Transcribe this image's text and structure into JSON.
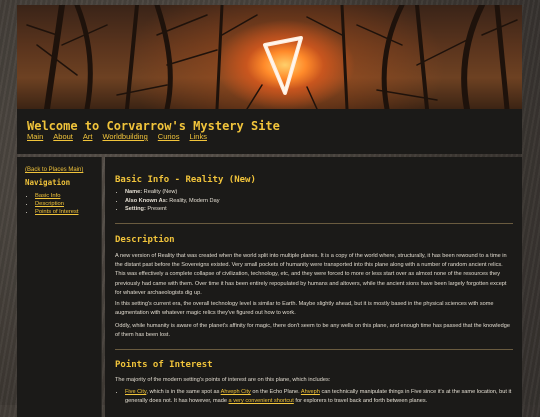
{
  "site": {
    "title": "Welcome to Corvarrow's Mystery Site",
    "nav": [
      "Main",
      "About",
      "Art",
      "Worldbuilding",
      "Curios",
      "Links"
    ]
  },
  "sidebar": {
    "back_link": "(Back to Places Main)",
    "heading": "Navigation",
    "items": [
      "Basic Info",
      "Description",
      "Points of Interest"
    ]
  },
  "main": {
    "basic_heading": "Basic Info - Reality (New)",
    "info": [
      {
        "label": "Name:",
        "value": "Reality (New)"
      },
      {
        "label": "Also Known As:",
        "value": "Reality, Modern Day"
      },
      {
        "label": "Setting:",
        "value": "Present"
      }
    ],
    "description_heading": "Description",
    "description_paragraphs": [
      "A new version of Reality that was created when the world split into multiple planes. It is a copy of the world where, structurally, it has been rewound to a time in the distant past before the Sovereigns existed. Very small pockets of humanity were transported into this plane along with a number of random ancient relics. This was effectively a complete collapse of civilization, technology, etc, and they were forced to more or less start over as almost none of the resources they previously had came with them. Over time it has been entirely repopulated by humans and altovers, while the ancient sions have been largely forgotten except for whatever archaeologists dig up.",
      "In this setting's current era, the overall technology level is similar to Earth. Maybe slightly ahead, but it is mostly based in the physical sciences with some augmentation with whatever magic relics they've figured out how to work.",
      "Oddly, while humanity is aware of the planet's affinity for magic, there don't seem to be any wells on this plane, and enough time has passed that the knowledge of them has been lost."
    ],
    "poi_heading": "Points of Interest",
    "poi_intro": "The majority of the modern setting's points of interest are on this plane, which includes:",
    "poi_item": {
      "link1": "Five City",
      "text1": ", which is in the same spot as ",
      "link2": "Ahveph City",
      "text2": " on the Echo Plane. ",
      "link3": "Ahveph",
      "text3": " can technically manipulate things in Five since it's at the same location, but it generally does not. It has however, made ",
      "link4": "a very convenient shortcut",
      "text4": " for explorers to travel back and forth between planes."
    }
  }
}
